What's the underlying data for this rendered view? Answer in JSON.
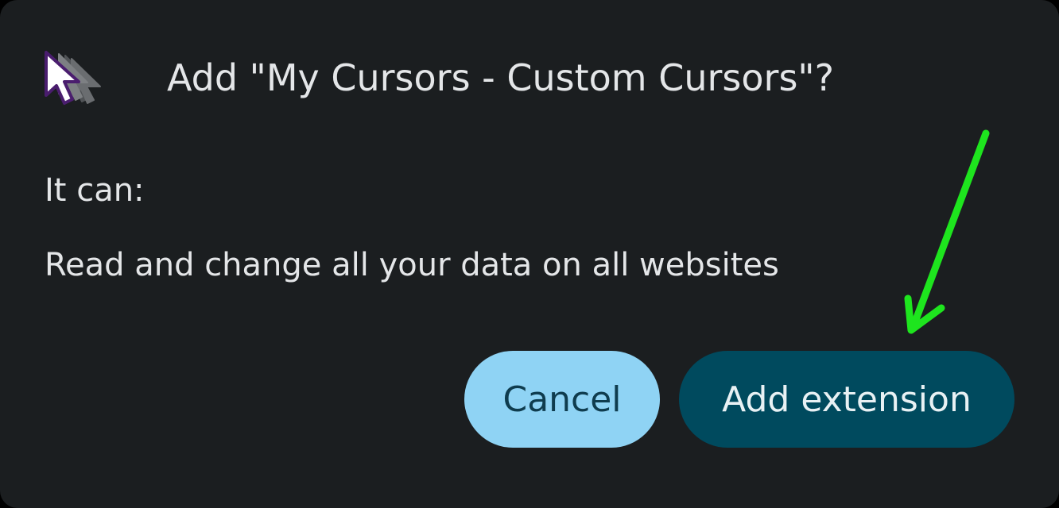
{
  "dialog": {
    "title": "Add \"My Cursors - Custom Cursors\"?",
    "permissions_label": "It can:",
    "permissions": [
      "Read and change all your data on all websites"
    ],
    "buttons": {
      "cancel_label": "Cancel",
      "add_label": "Add extension"
    }
  },
  "colors": {
    "background": "#1b1e20",
    "text": "#e4e6e8",
    "cancel_button_bg": "#8fd3f4",
    "cancel_button_text": "#0f3c4e",
    "add_button_bg": "#004a5e",
    "add_button_text": "#e8f1f4",
    "annotation_arrow": "#1ee51e"
  },
  "icons": {
    "extension": "cursor-icon",
    "annotation": "arrow-icon"
  }
}
